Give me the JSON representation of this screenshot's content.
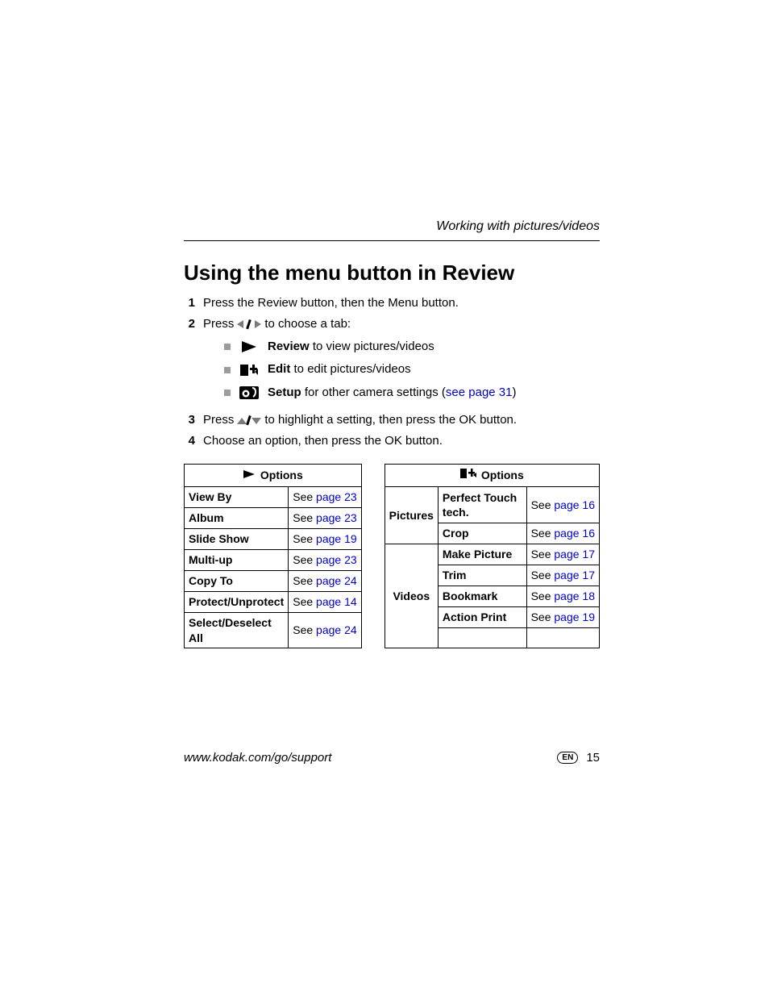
{
  "header": {
    "running": "Working with pictures/videos"
  },
  "title": "Using the menu button in Review",
  "steps": {
    "s1": "Press the Review button, then the Menu button.",
    "s2a": "Press ",
    "s2b": " to choose a tab:",
    "tabs": {
      "review": {
        "label": "Review",
        "desc": " to view pictures/videos"
      },
      "edit": {
        "label": "Edit",
        "desc": " to edit pictures/videos"
      },
      "setup": {
        "label": "Setup",
        "desc_a": " for other camera settings (",
        "link": "see page 31",
        "desc_b": ")"
      }
    },
    "s3a": "Press ",
    "s3b": " to highlight a setting, then press the OK button.",
    "s4": "Choose an option, then press the OK button."
  },
  "tableLeft": {
    "heading": "Options",
    "rows": [
      {
        "name": "View By",
        "see": "See ",
        "link": "page 23"
      },
      {
        "name": "Album",
        "see": "See ",
        "link": "page 23"
      },
      {
        "name": "Slide Show",
        "see": "See ",
        "link": "page 19"
      },
      {
        "name": "Multi-up",
        "see": "See ",
        "link": "page 23"
      },
      {
        "name": "Copy To",
        "see": "See ",
        "link": "page 24"
      },
      {
        "name": "Protect/Unprotect",
        "see": "See ",
        "link": "page 14"
      },
      {
        "name": "Select/Deselect All",
        "see": "See ",
        "link": "page 24"
      }
    ]
  },
  "tableRight": {
    "heading": "Options",
    "groups": {
      "pictures": {
        "label": "Pictures",
        "rows": [
          {
            "name": "Perfect Touch tech.",
            "see": "See ",
            "link": "page 16"
          },
          {
            "name": "Crop",
            "see": "See ",
            "link": "page 16"
          }
        ]
      },
      "videos": {
        "label": "Videos",
        "rows": [
          {
            "name": "Make Picture",
            "see": "See ",
            "link": "page 17"
          },
          {
            "name": "Trim",
            "see": "See ",
            "link": "page 17"
          },
          {
            "name": "Bookmark",
            "see": "See ",
            "link": "page 18"
          },
          {
            "name": "Action Print",
            "see": "See ",
            "link": "page 19"
          }
        ]
      }
    }
  },
  "footer": {
    "url": "www.kodak.com/go/support",
    "lang": "EN",
    "page": "15"
  }
}
